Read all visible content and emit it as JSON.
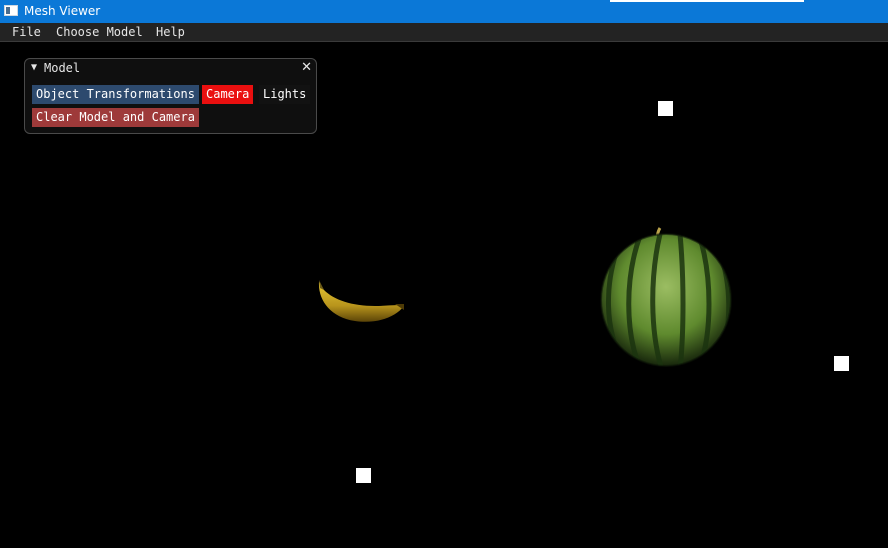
{
  "window": {
    "title": "Mesh Viewer",
    "icon": "app-window-icon"
  },
  "menu": {
    "items": [
      "File",
      "Choose Model",
      "Help"
    ]
  },
  "panel": {
    "title": "Model",
    "collapse_icon": "triangle-down-icon",
    "close_icon": "close-icon",
    "buttons": {
      "object_transformations": "Object Transformations",
      "camera": "Camera",
      "lights": "Lights",
      "clear": "Clear Model and Camera"
    },
    "colors": {
      "object_button": "#2d4a6e",
      "camera_button": "#ea0f0f",
      "clear_button": "#9e3a3a"
    }
  },
  "scene": {
    "objects": [
      "banana",
      "watermelon"
    ],
    "light_markers": 3,
    "background": "#000000"
  }
}
